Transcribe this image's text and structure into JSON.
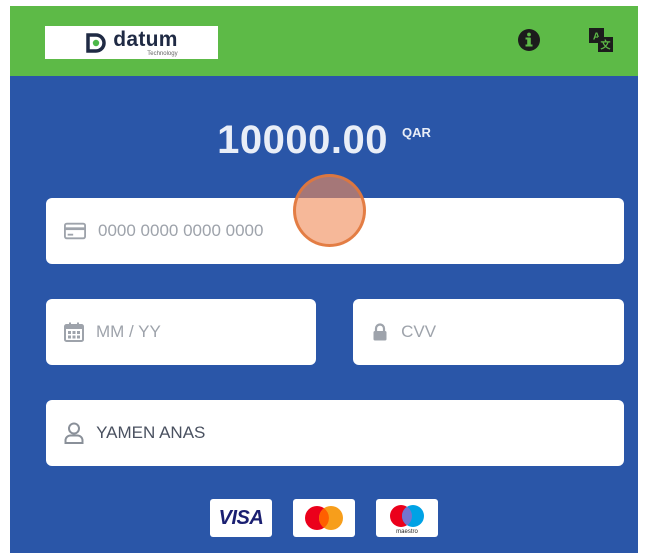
{
  "header": {
    "logo_name": "datum",
    "logo_sub": "Technology",
    "bg_color": "#5dba47",
    "icons": [
      "info-icon",
      "translate-icon"
    ]
  },
  "payment": {
    "amount": "10000.00",
    "currency": "QAR"
  },
  "form": {
    "card_number": {
      "value": "",
      "placeholder": "0000 0000 0000 0000",
      "icon": "credit-card-icon"
    },
    "expiry": {
      "value": "",
      "placeholder": "MM / YY",
      "icon": "calendar-icon"
    },
    "cvv": {
      "value": "",
      "placeholder": "CVV",
      "icon": "lock-icon"
    },
    "holder_name": {
      "value": "YAMEN ANAS",
      "placeholder": "",
      "icon": "user-icon"
    }
  },
  "brands": {
    "visa": "VISA",
    "maestro": "maestro"
  },
  "colors": {
    "panel": "#2a56a8",
    "header": "#5dba47"
  }
}
